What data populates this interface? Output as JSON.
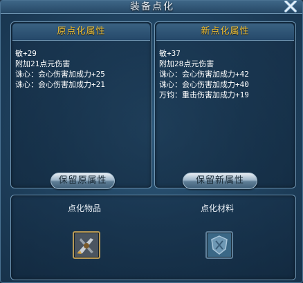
{
  "window": {
    "title": "装备点化"
  },
  "original_panel": {
    "title": "原点化属性",
    "attributes": [
      "敏+29",
      "附加21点元伤害",
      "诛心：会心伤害加成力+25",
      "诛心：会心伤害加成力+21"
    ],
    "button_label": "保留原属性"
  },
  "new_panel": {
    "title": "新点化属性",
    "attributes": [
      "敏+37",
      "附加28点元伤害",
      "诛心：会心伤害加成力+42",
      "诛心：会心伤害加成力+40",
      "万钧：重击伤害加成力+19"
    ],
    "button_label": "保留新属性"
  },
  "slots": {
    "item_label": "点化物品",
    "material_label": "点化材料",
    "item_icon": "sword-item-icon",
    "material_icon": "shield-material-icon"
  },
  "colors": {
    "panel_title": "#f0c23a",
    "text": "#ffffff",
    "border": "#6f95b2",
    "slot_border": "#b99a56"
  }
}
